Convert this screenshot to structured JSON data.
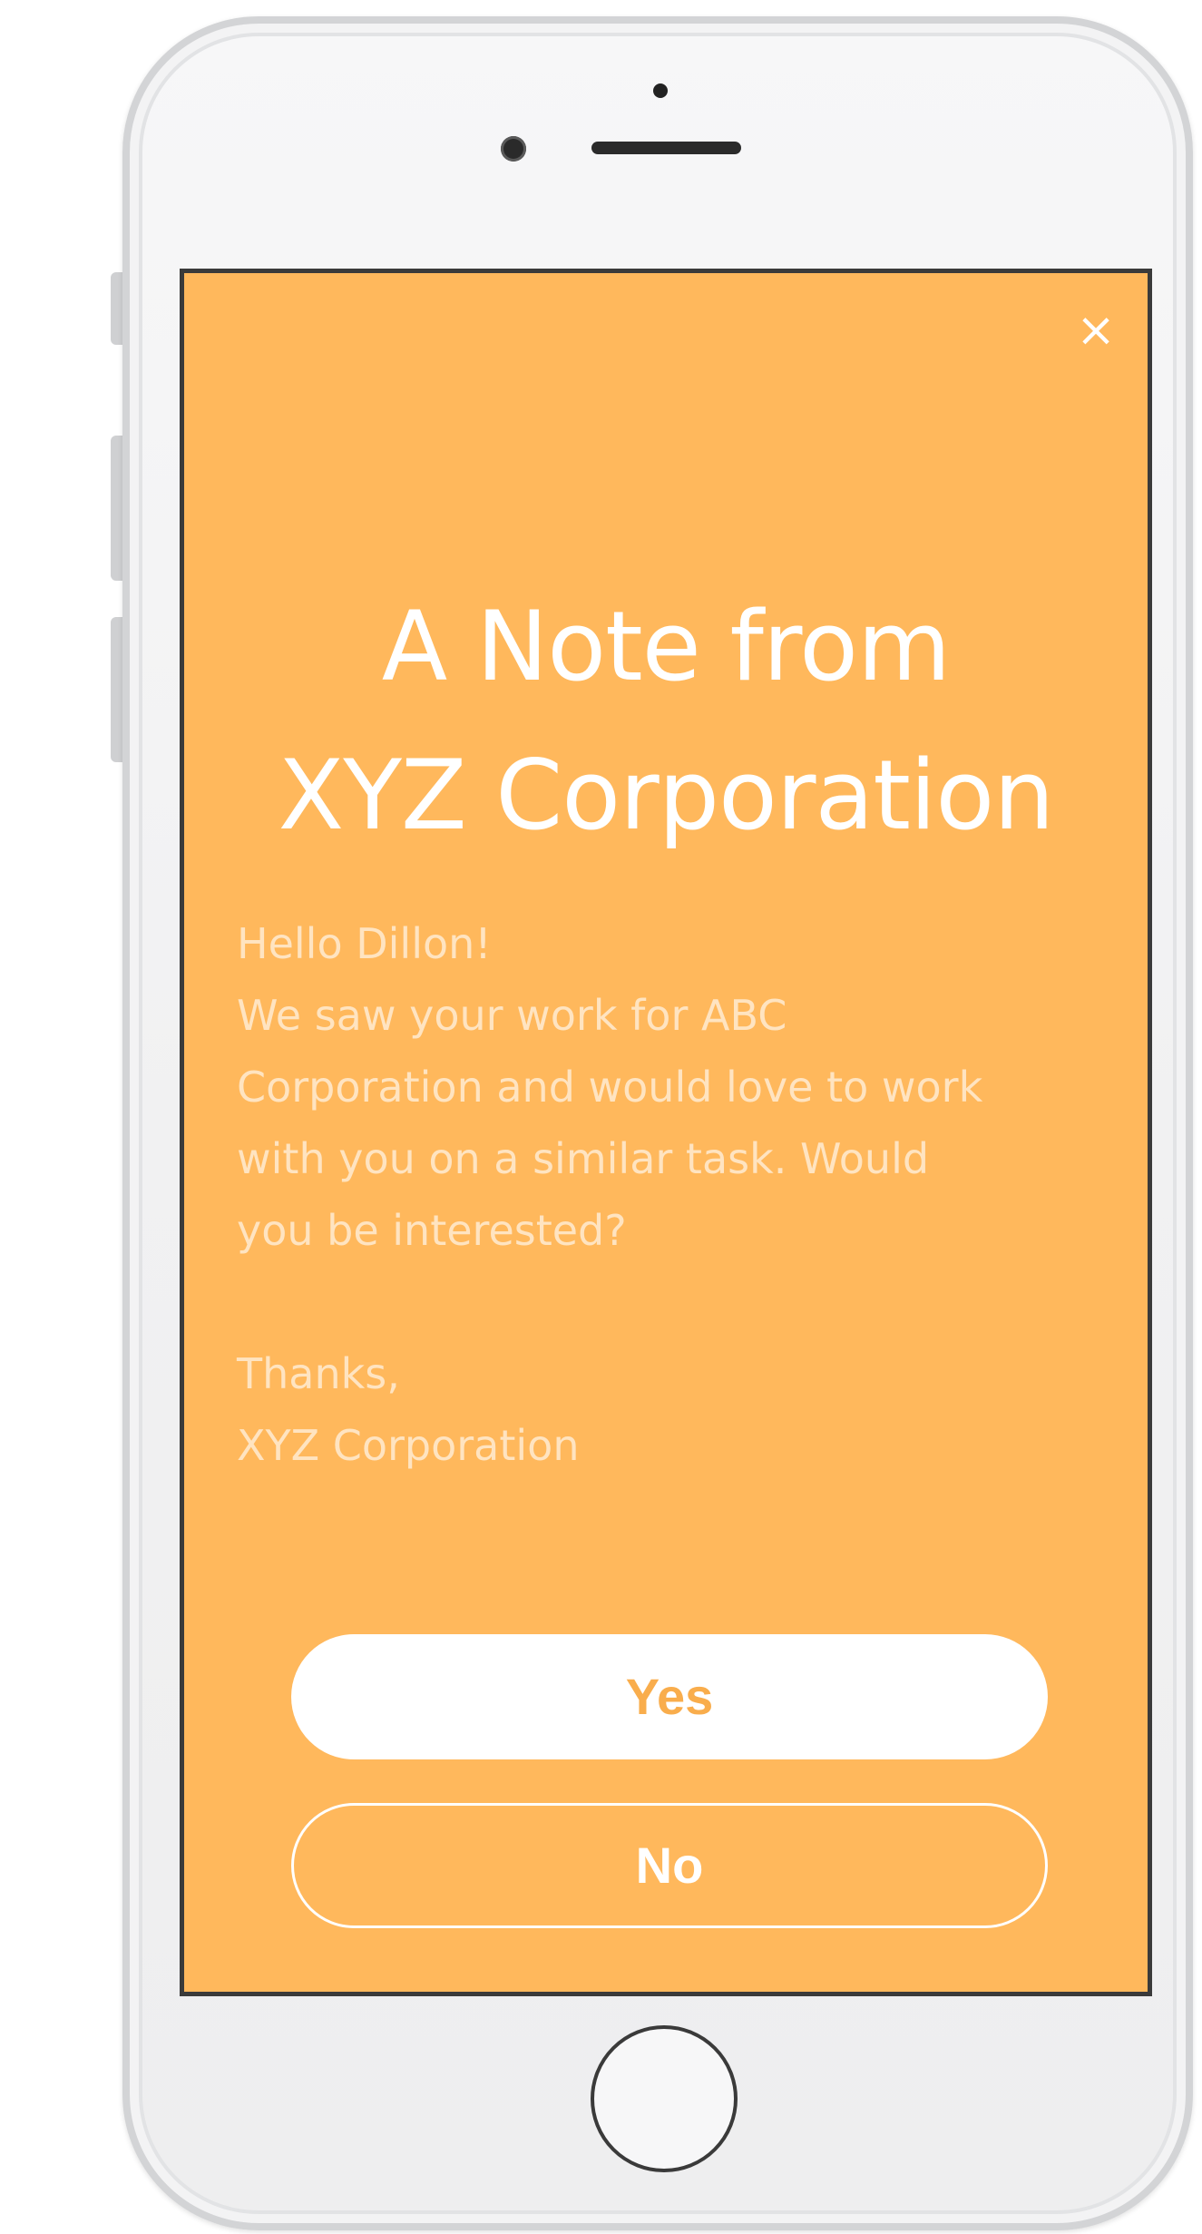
{
  "dialog": {
    "close_glyph": "×",
    "title_line1": "A Note from",
    "title_line2": "XYZ Corporation",
    "message_lines": [
      "Hello Dillon!",
      "We saw your work for ABC",
      "Corporation and would love to work",
      "with you on a similar task. Would",
      "you be interested?",
      "Thanks,",
      "XYZ Corporation"
    ],
    "yes_label": "Yes",
    "no_label": "No"
  },
  "colors": {
    "screen_background": "#ffb85c",
    "yes_text": "#f9ad4c",
    "text": "#ffffff"
  }
}
